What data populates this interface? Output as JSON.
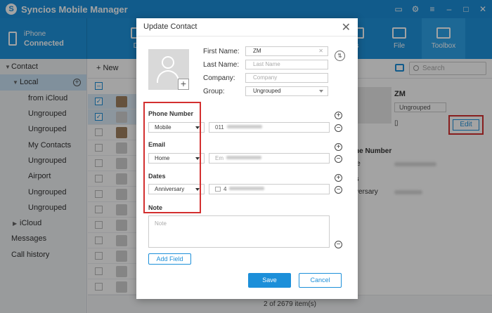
{
  "app": {
    "title": "Syncios Mobile Manager",
    "logo": "syncios-logo"
  },
  "device": {
    "name": "iPhone",
    "status": "Connected"
  },
  "toolbar": {
    "items": [
      {
        "label": "Device",
        "visible_label": "De"
      },
      {
        "label": "Apps",
        "visible_label": "s"
      },
      {
        "label": "File"
      },
      {
        "label": "Toolbox"
      }
    ]
  },
  "sidebar": {
    "contact": "Contact",
    "local": "Local",
    "groups": [
      "from iCloud",
      "Ungrouped",
      "Ungrouped",
      "My Contacts",
      "Ungrouped",
      "Airport",
      "Ungrouped",
      "Ungrouped"
    ],
    "icloud": "iCloud",
    "messages": "Messages",
    "call_history": "Call history"
  },
  "main": {
    "new_label": "New",
    "search_placeholder": "Search",
    "footer": "2 of 2679 item(s)",
    "detail": {
      "name": "ZM",
      "group": "Ungrouped",
      "edit_label": "Edit",
      "sec_phone": "ne Number",
      "label_mobile": "le",
      "sec_anniv": "s",
      "label_anniv": "versary"
    }
  },
  "dialog": {
    "title": "Update Contact",
    "first_name_label": "First Name:",
    "first_name_value": "ZM",
    "last_name_label": "Last Name:",
    "last_name_placeholder": "Last Name",
    "company_label": "Company:",
    "company_placeholder": "Company",
    "group_label": "Group:",
    "group_value": "Ungrouped",
    "phone_section": "Phone Number",
    "phone_type": "Mobile",
    "phone_value_prefix": "011",
    "email_section": "Email",
    "email_type": "Home",
    "email_placeholder_prefix": "Em",
    "dates_section": "Dates",
    "dates_type": "Anniversary",
    "dates_value_prefix": "4",
    "note_section": "Note",
    "note_placeholder": "Note",
    "add_field": "Add Field",
    "save": "Save",
    "cancel": "Cancel"
  },
  "colors": {
    "brand": "#1c8fd9",
    "highlight": "#d32f2f"
  }
}
